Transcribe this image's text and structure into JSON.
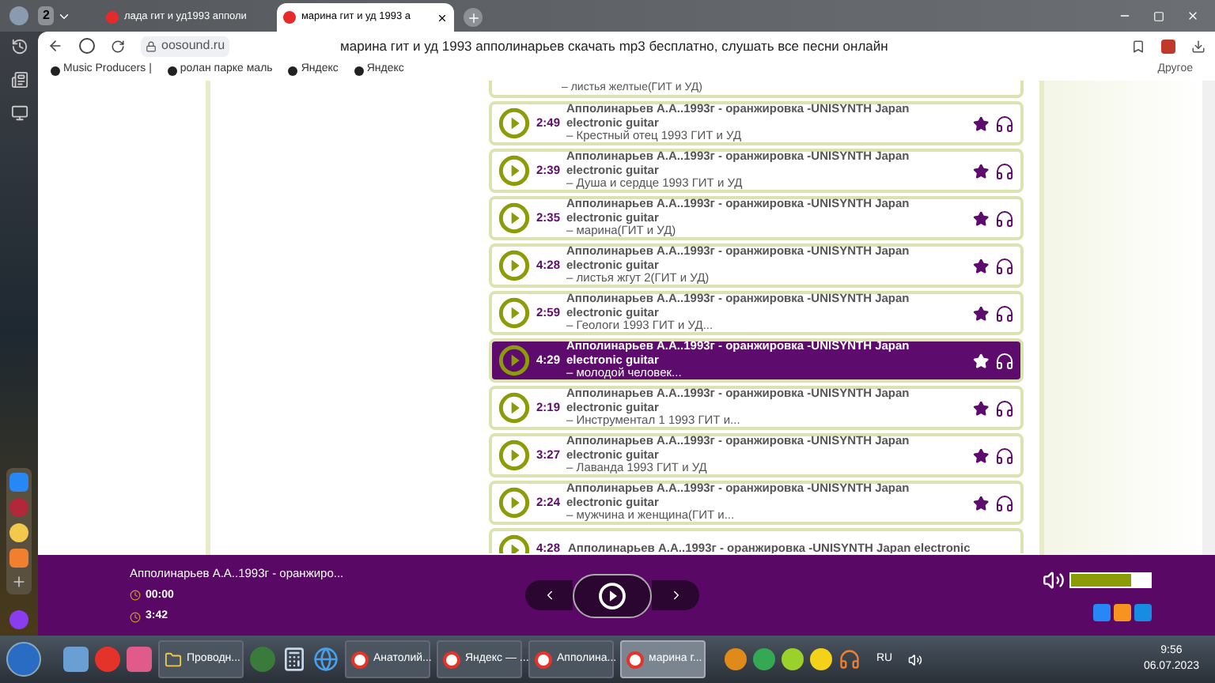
{
  "browser": {
    "tab_count": "2",
    "tabs": [
      {
        "title": "лада гит и уд1993 апполи",
        "selected": false
      },
      {
        "title": "марина гит и уд 1993 а",
        "selected": true
      }
    ],
    "address": "oosound.ru",
    "page_title": "марина гит и уд 1993 апполинарьев скачать mp3 бесплатно, слушать все песни онлайн",
    "bookmarks": [
      "Music Producers |",
      "ролан парке маль",
      "Яндекс",
      "Яндекс"
    ],
    "bookmarks_other": "Другое"
  },
  "tracks": {
    "top_partial_subtitle": "– листья желтые(ГИТ и УД)",
    "rows": [
      {
        "duration": "2:49",
        "title": "Апполинарьев А.А..1993г - оранжировка -UNISYNTH Japan electronic guitar",
        "subtitle": "– Крестный отец 1993 ГИТ и УД",
        "selected": false
      },
      {
        "duration": "2:39",
        "title": "Апполинарьев А.А..1993г - оранжировка -UNISYNTH Japan electronic guitar",
        "subtitle": "– Душа и сердце 1993 ГИТ и УД",
        "selected": false
      },
      {
        "duration": "2:35",
        "title": "Апполинарьев А.А..1993г - оранжировка -UNISYNTH Japan electronic guitar",
        "subtitle": "– марина(ГИТ и УД)",
        "selected": false
      },
      {
        "duration": "4:28",
        "title": "Апполинарьев А.А..1993г - оранжировка -UNISYNTH Japan electronic guitar",
        "subtitle": "– листья жгут 2(ГИТ и УД)",
        "selected": false
      },
      {
        "duration": "2:59",
        "title": "Апполинарьев А.А..1993г - оранжировка -UNISYNTH Japan electronic guitar",
        "subtitle": "– Геологи 1993 ГИТ и УД...",
        "selected": false
      },
      {
        "duration": "4:29",
        "title": "Апполинарьев А.А..1993г - оранжировка -UNISYNTH Japan electronic guitar",
        "subtitle": "– молодой человек...",
        "selected": true
      },
      {
        "duration": "2:19",
        "title": "Апполинарьев А.А..1993г - оранжировка -UNISYNTH Japan electronic guitar",
        "subtitle": "– Инструментал 1 1993 ГИТ и...",
        "selected": false
      },
      {
        "duration": "3:27",
        "title": "Апполинарьев А.А..1993г - оранжировка -UNISYNTH Japan electronic guitar",
        "subtitle": "– Лаванда 1993 ГИТ и УД",
        "selected": false
      },
      {
        "duration": "2:24",
        "title": "Апполинарьев А.А..1993г - оранжировка -UNISYNTH Japan electronic guitar",
        "subtitle": "– мужчина и женщина(ГИТ и...",
        "selected": false
      }
    ],
    "bottom_partial": {
      "duration": "4:28",
      "title": "Апполинарьев А.А..1993г - оранжировка -UNISYNTH Japan electronic"
    }
  },
  "player": {
    "title": "Апполинарьев А.А..1993г - оранжиро...",
    "elapsed": "00:00",
    "total": "3:42",
    "volume": {
      "level": 0.75
    }
  },
  "taskbar": {
    "windows": [
      {
        "label": "Проводн...",
        "selected": false
      },
      {
        "label": "Анатолий...",
        "selected": false
      },
      {
        "label": "Яндекс — ...",
        "selected": false
      },
      {
        "label": "Апполина...",
        "selected": false
      },
      {
        "label": "марина г...",
        "selected": true
      }
    ],
    "language": "RU",
    "time": "9:56",
    "date": "06.07.2023"
  }
}
